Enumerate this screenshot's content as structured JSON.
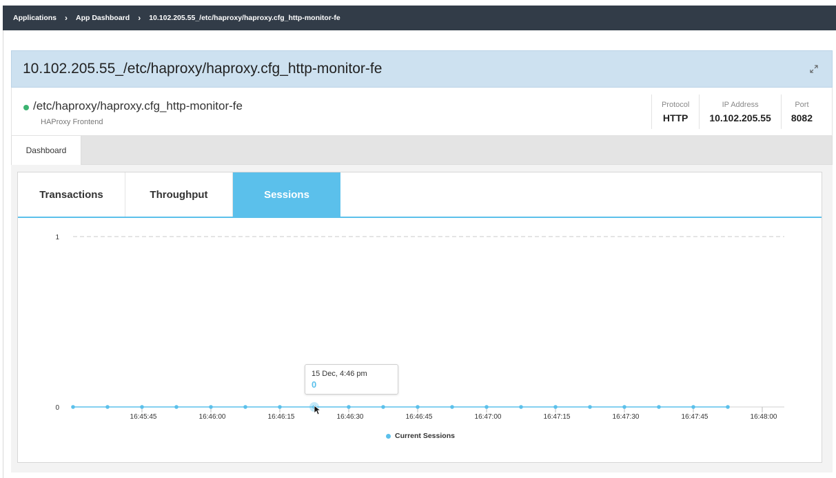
{
  "breadcrumb": {
    "items": [
      "Applications",
      "App Dashboard",
      "10.102.205.55_/etc/haproxy/haproxy.cfg_http-monitor-fe"
    ],
    "separator": "›"
  },
  "header": {
    "title": "10.102.205.55_/etc/haproxy/haproxy.cfg_http-monitor-fe",
    "expand_icon": "expand-icon"
  },
  "info": {
    "status": "up",
    "status_color": "#3cb371",
    "name": "/etc/haproxy/haproxy.cfg_http-monitor-fe",
    "type": "HAProxy Frontend",
    "protocol_label": "Protocol",
    "protocol_value": "HTTP",
    "ip_label": "IP Address",
    "ip_value": "10.102.205.55",
    "port_label": "Port",
    "port_value": "8082"
  },
  "dashboard_tab": "Dashboard",
  "chart_tabs": [
    "Transactions",
    "Throughput",
    "Sessions"
  ],
  "active_chart_tab": "Sessions",
  "accent_color": "#5bc0eb",
  "tooltip": {
    "date": "15 Dec, 4:46 pm",
    "value": "0"
  },
  "chart_data": {
    "type": "line",
    "title": "",
    "xlabel": "",
    "ylabel": "",
    "ylim": [
      0,
      1
    ],
    "yticks": [
      "0",
      "1"
    ],
    "xticks": [
      "16:45:45",
      "16:46:00",
      "16:46:15",
      "16:46:30",
      "16:46:45",
      "16:47:00",
      "16:47:15",
      "16:47:30",
      "16:47:45",
      "16:48:00"
    ],
    "series": [
      {
        "name": "Current Sessions",
        "color": "#5bc0eb",
        "x": [
          "16:45:30",
          "16:45:37.5",
          "16:45:45",
          "16:45:52.5",
          "16:46:00",
          "16:46:07.5",
          "16:46:15",
          "16:46:22.5",
          "16:46:30",
          "16:46:37.5",
          "16:46:45",
          "16:46:52.5",
          "16:47:00",
          "16:47:07.5",
          "16:47:15",
          "16:47:22.5",
          "16:47:30",
          "16:47:37.5",
          "16:47:45",
          "16:47:52.5"
        ],
        "values": [
          0,
          0,
          0,
          0,
          0,
          0,
          0,
          0,
          0,
          0,
          0,
          0,
          0,
          0,
          0,
          0,
          0,
          0,
          0,
          0
        ]
      }
    ],
    "grid": true,
    "legend": "bottom-center"
  }
}
